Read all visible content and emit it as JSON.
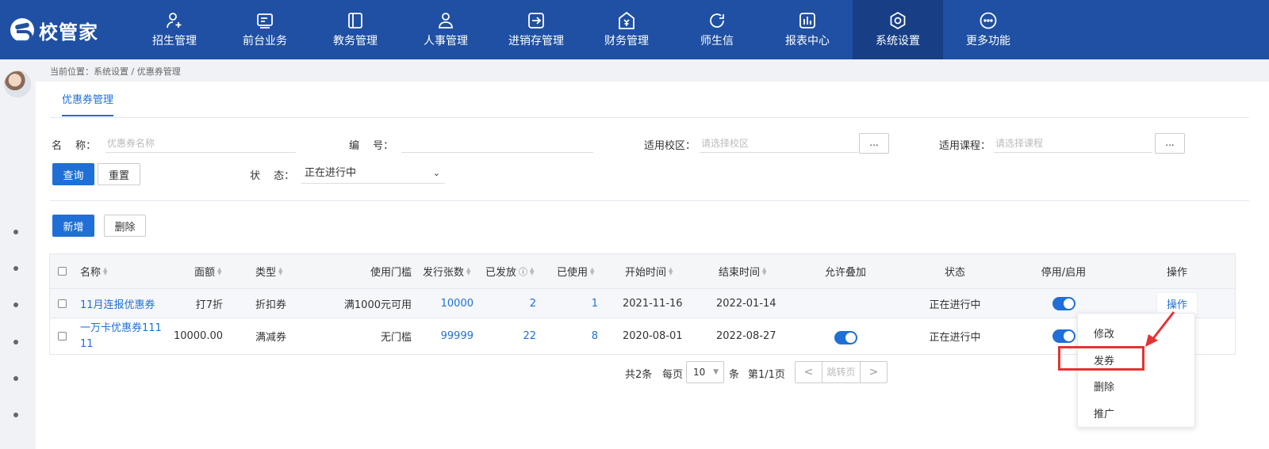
{
  "app": {
    "logo_text": "校管家"
  },
  "nav": [
    {
      "label": "招生管理",
      "icon": "person-add-icon"
    },
    {
      "label": "前台业务",
      "icon": "screen-icon"
    },
    {
      "label": "教务管理",
      "icon": "book-icon"
    },
    {
      "label": "人事管理",
      "icon": "person-icon"
    },
    {
      "label": "进销存管理",
      "icon": "arrow-box-icon"
    },
    {
      "label": "财务管理",
      "icon": "yen-icon"
    },
    {
      "label": "师生信",
      "icon": "chat-icon"
    },
    {
      "label": "报表中心",
      "icon": "bars-icon"
    },
    {
      "label": "系统设置",
      "icon": "gear-hex-icon",
      "active": true
    },
    {
      "label": "更多功能",
      "icon": "more-circle-icon"
    }
  ],
  "breadcrumb": "当前位置：系统设置 / 优惠券管理",
  "tab": {
    "label": "优惠券管理"
  },
  "filters": {
    "name_label": "名　 称：",
    "name_placeholder": "优惠券名称",
    "code_label": "编　 号：",
    "code_placeholder": "",
    "campus_label": "适用校区：",
    "campus_placeholder": "请选择校区",
    "course_label": "适用课程：",
    "course_placeholder": "请选择课程",
    "dots": "...",
    "status_label": "状　 态：",
    "status_value": "正在进行中",
    "query_btn": "查询",
    "reset_btn": "重置"
  },
  "actions": {
    "add_btn": "新增",
    "delete_btn": "删除"
  },
  "table": {
    "headers": {
      "name": "名称",
      "amount": "面额",
      "type": "类型",
      "threshold": "使用门槛",
      "issued": "发行张数",
      "distributed": "已发放",
      "used": "已使用",
      "start": "开始时间",
      "end": "结束时间",
      "stack": "允许叠加",
      "status": "状态",
      "toggle": "停用/启用",
      "op": "操作"
    },
    "rows": [
      {
        "name": "11月连报优惠券",
        "amount": "打7折",
        "type": "折扣券",
        "threshold": "满1000元可用",
        "issued": "10000",
        "distributed": "2",
        "used": "1",
        "start": "2021-11-16",
        "end": "2022-01-14",
        "stack": false,
        "status": "正在进行中",
        "enabled": true,
        "op": "操作"
      },
      {
        "name": "一万卡优惠券11111",
        "amount": "10000.00",
        "type": "满减券",
        "threshold": "无门槛",
        "issued": "99999",
        "distributed": "22",
        "used": "8",
        "start": "2020-08-01",
        "end": "2022-08-27",
        "stack": true,
        "status": "正在进行中",
        "enabled": true,
        "op": ""
      }
    ]
  },
  "pagination": {
    "total": "共2条",
    "per_page_label": "每页",
    "per_page": "10",
    "unit": "条",
    "page": "第1/1页",
    "jump_placeholder": "跳转页",
    "prev": "<",
    "next": ">"
  },
  "menu": {
    "items": [
      "修改",
      "发券",
      "删除",
      "推广"
    ],
    "highlighted": "发券"
  },
  "colors": {
    "nav_bg": "#1f50a3",
    "accent": "#1f6fd6",
    "highlight": "#e53333"
  }
}
